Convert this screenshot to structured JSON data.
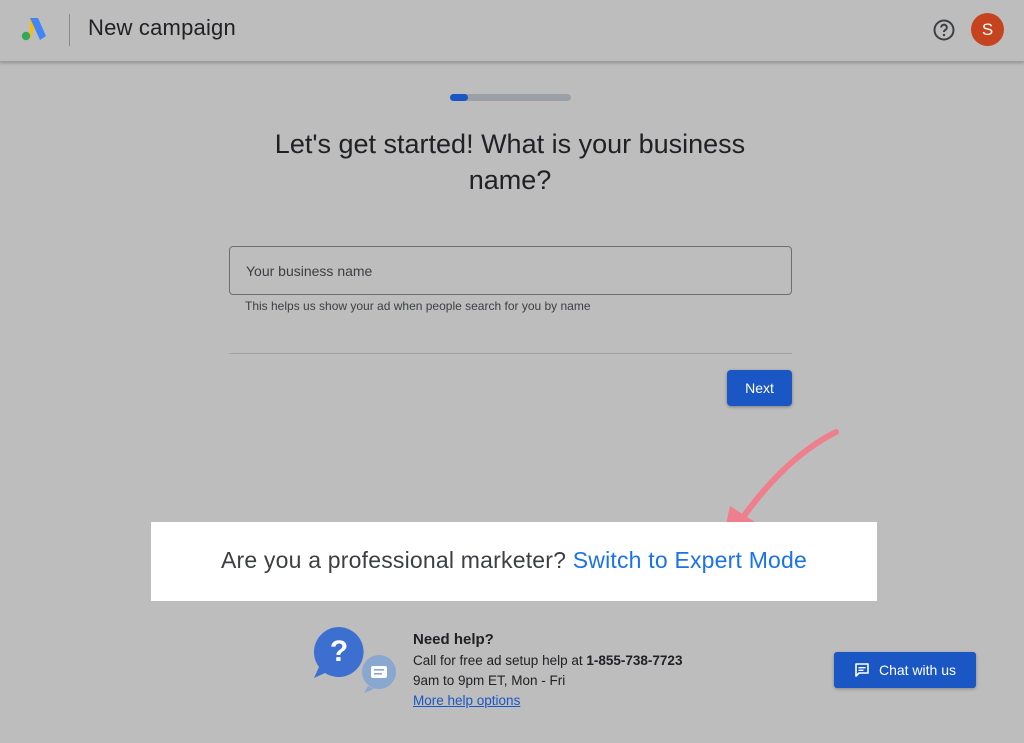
{
  "header": {
    "title": "New campaign",
    "logo_icon": "google-ads-logo",
    "help_icon": "help-circle-icon",
    "avatar_letter": "S"
  },
  "progress": {
    "fraction": 0.15
  },
  "main": {
    "heading": "Let's get started! What is your business name?",
    "input": {
      "placeholder": "Your business name",
      "value": ""
    },
    "helper_text": "This helps us show your ad when people search for you by name",
    "next_label": "Next"
  },
  "expert": {
    "prompt": "Are you a professional marketer?",
    "link": "Switch to Expert Mode"
  },
  "help": {
    "title": "Need help?",
    "call_text": "Call for free ad setup help at",
    "phone": "1-855-738-7723",
    "hours": "9am to 9pm ET, Mon - Fri",
    "more_link": "More help options"
  },
  "chat": {
    "label": "Chat with us",
    "icon": "chat-icon"
  },
  "colors": {
    "background": "#bdbdbd",
    "primary": "#1a56c4",
    "link": "#1a73e8",
    "avatar": "#c5441f",
    "annotation_arrow": "#ef7f8c"
  }
}
